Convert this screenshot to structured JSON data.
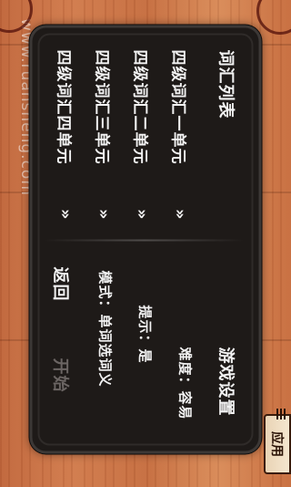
{
  "watermark": "www.ruansheng.com",
  "side_tab_label": "应用",
  "vocab_panel": {
    "title": "词汇列表",
    "items": [
      {
        "label": "四级词汇一单元",
        "chevron": "»"
      },
      {
        "label": "四级词汇二单元",
        "chevron": "»"
      },
      {
        "label": "四级词汇三单元",
        "chevron": "»"
      },
      {
        "label": "四级词汇四单元",
        "chevron": "»"
      }
    ]
  },
  "settings_panel": {
    "title": "游戏设置",
    "difficulty": "难度：容易",
    "hint": "提示：是",
    "mode": "模式：单词选词义"
  },
  "actions": {
    "back": "返回",
    "start": "开始"
  },
  "colors": {
    "dialog_bg": "#1e1a18",
    "text": "#f2f2f2",
    "disabled_text": "#6b6563",
    "wood": "#c96f42"
  }
}
